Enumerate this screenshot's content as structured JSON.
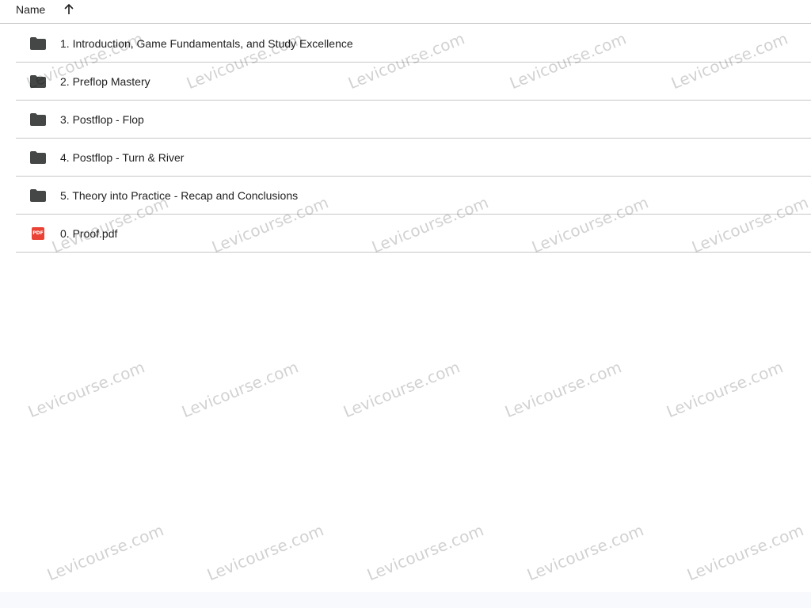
{
  "header": {
    "name_label": "Name",
    "sort_icon": "arrow-up-icon"
  },
  "items": [
    {
      "label": "1. Introduction, Game Fundamentals, and Study Excellence",
      "type": "folder"
    },
    {
      "label": "2. Preflop Mastery",
      "type": "folder"
    },
    {
      "label": "3. Postflop - Flop",
      "type": "folder"
    },
    {
      "label": "4. Postflop - Turn & River",
      "type": "folder"
    },
    {
      "label": "5. Theory into Practice - Recap and Conclusions",
      "type": "folder"
    },
    {
      "label": "0. Proof.pdf",
      "type": "pdf",
      "badge": "PDF"
    }
  ],
  "watermark": "Levicourse.com",
  "colors": {
    "folder": "#444746",
    "pdf": "#ea4335",
    "divider": "#c7c7c7"
  }
}
